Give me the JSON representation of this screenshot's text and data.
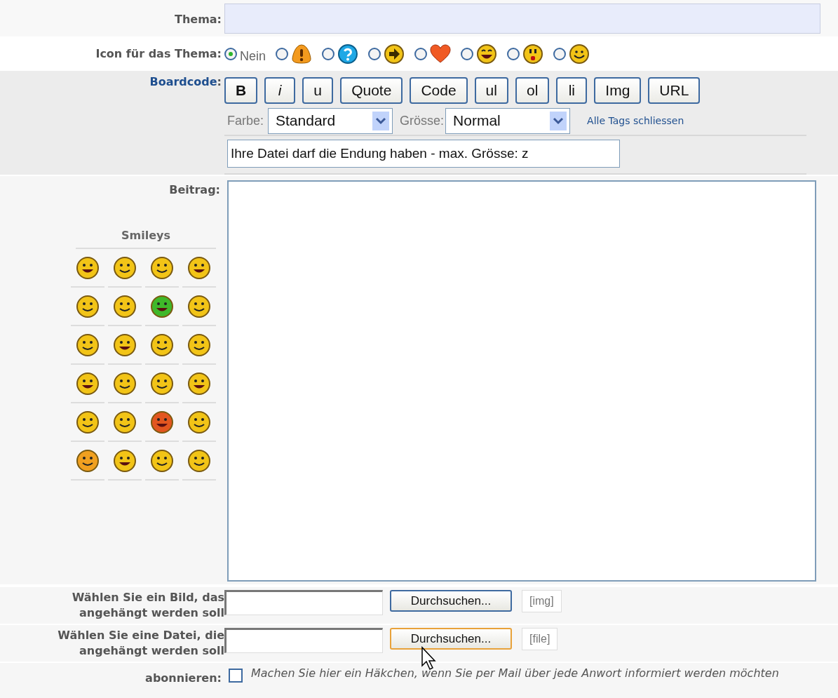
{
  "topic": {
    "label": "Thema:"
  },
  "topic_icon": {
    "label": "Icon für das Thema:",
    "options": [
      {
        "kind": "none",
        "label": "Nein",
        "selected": true
      },
      {
        "kind": "warning",
        "selected": false
      },
      {
        "kind": "question",
        "selected": false
      },
      {
        "kind": "arrow",
        "selected": false
      },
      {
        "kind": "heart",
        "selected": false
      },
      {
        "kind": "grin",
        "selected": false
      },
      {
        "kind": "surprised",
        "selected": false
      },
      {
        "kind": "smile",
        "selected": false
      }
    ]
  },
  "boardcode": {
    "label": "Boardcode",
    "colon": ":",
    "buttons": [
      "B",
      "i",
      "u",
      "Quote",
      "Code",
      "ul",
      "ol",
      "li",
      "Img",
      "URL"
    ],
    "color_label": "Farbe:",
    "color_value": "Standard",
    "size_label": "Grösse:",
    "size_value": "Normal",
    "close_tags": "Alle Tags schliessen",
    "info": "Ihre Datei darf die Endung haben - max. Grösse: z"
  },
  "post": {
    "label": "Beitrag:",
    "smileys_title": "Smileys",
    "smileys": [
      {
        "color": "#f2c417"
      },
      {
        "color": "#f2c417"
      },
      {
        "color": "#f2c417"
      },
      {
        "color": "#f2c417"
      },
      {
        "color": "#f2c417"
      },
      {
        "color": "#f2c417"
      },
      {
        "color": "#3fb82a"
      },
      {
        "color": "#f2c417"
      },
      {
        "color": "#f2c417"
      },
      {
        "color": "#f2c417"
      },
      {
        "color": "#f2c417"
      },
      {
        "color": "#f2c417"
      },
      {
        "color": "#f2c417"
      },
      {
        "color": "#f2c417"
      },
      {
        "color": "#f2c417"
      },
      {
        "color": "#f2c417"
      },
      {
        "color": "#f2c417"
      },
      {
        "color": "#f2c417"
      },
      {
        "color": "#e2561f"
      },
      {
        "color": "#f2c417"
      },
      {
        "color": "#f0a020"
      },
      {
        "color": "#f2c417"
      },
      {
        "color": "#f2c417"
      },
      {
        "color": "#f2c417"
      }
    ]
  },
  "attachments": [
    {
      "label": "Wählen Sie ein Bild, das angehängt werden soll",
      "button": "Durchsuchen...",
      "hovered": false,
      "tag": "[img]"
    },
    {
      "label": "Wählen Sie eine Datei, die angehängt werden soll",
      "button": "Durchsuchen...",
      "hovered": true,
      "tag": "[file]"
    }
  ],
  "subscribe": {
    "label": "abonnieren:",
    "checked": false,
    "text": "Machen Sie hier ein Häkchen, wenn Sie per Mail über jede Anwort informiert werden möchten"
  }
}
